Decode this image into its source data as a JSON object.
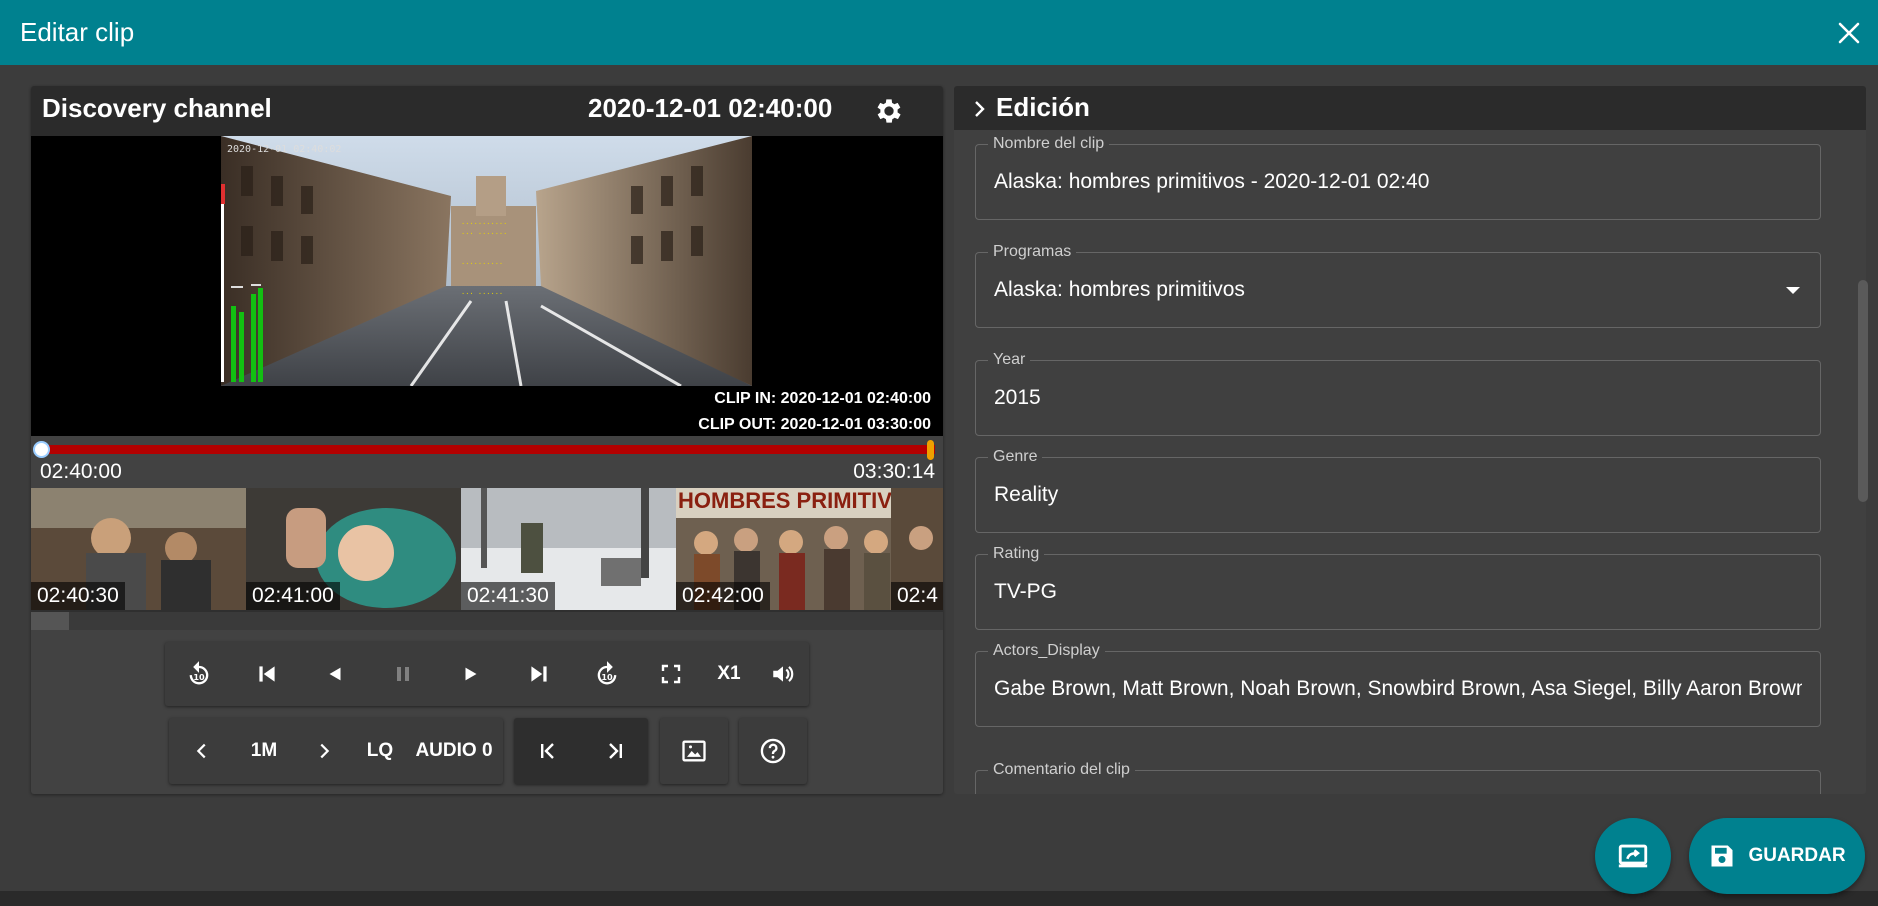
{
  "dialog": {
    "title": "Editar clip"
  },
  "player": {
    "channel": "Discovery channel",
    "datetime": "2020-12-01 02:40:00",
    "frame_timestamp": "2020-12-01 02:40:02",
    "clip_in": "CLIP IN: 2020-12-01 02:40:00",
    "clip_out": "CLIP OUT: 2020-12-01 03:30:00",
    "timeline_start": "02:40:00",
    "timeline_end": "03:30:14",
    "thumbnails": [
      {
        "time": "02:40:30",
        "scene": "workshop"
      },
      {
        "time": "02:41:00",
        "scene": "baby"
      },
      {
        "time": "02:41:30",
        "scene": "snow"
      },
      {
        "time": "02:42:00",
        "scene": "title",
        "title_text": "HOMBRES PRIMITIVOS"
      },
      {
        "time": "02:4",
        "scene": "partial"
      }
    ],
    "controls": {
      "speed": "X1",
      "step": "1M",
      "quality": "LQ",
      "audio": "AUDIO 0"
    }
  },
  "edicion": {
    "header": "Edición",
    "fields": [
      {
        "label": "Nombre del clip",
        "value": "Alaska: hombres primitivos - 2020-12-01 02:40"
      },
      {
        "label": "Programas",
        "value": "Alaska: hombres primitivos",
        "dropdown": true
      },
      {
        "label": "Year",
        "value": "2015"
      },
      {
        "label": "Genre",
        "value": "Reality"
      },
      {
        "label": "Rating",
        "value": "TV-PG"
      },
      {
        "label": "Actors_Display",
        "value": "Gabe Brown, Matt Brown, Noah Brown, Snowbird Brown, Asa Siegel, Billy Aaron Brown"
      },
      {
        "label": "Comentario del clip",
        "value": ""
      }
    ]
  },
  "actions": {
    "save_label": "GUARDAR"
  },
  "colors": {
    "teal": "#00818f",
    "timeline_red": "#b30000",
    "audio_meter": "#12c012",
    "out_marker": "#f0a000"
  }
}
